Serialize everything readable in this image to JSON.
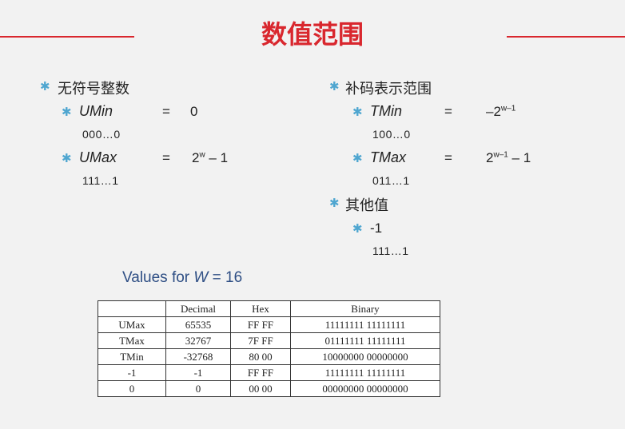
{
  "title": "数值范围",
  "left": {
    "heading": "无符号整数",
    "umin_name": "UMin",
    "umin_eq": "=",
    "umin_val": "0",
    "umin_bits": "000…0",
    "umax_name": "UMax",
    "umax_eq": "=",
    "umax_base": "2",
    "umax_exp": "w",
    "umax_tail": " – 1",
    "umax_bits": "111…1"
  },
  "right": {
    "heading": "补码表示范围",
    "tmin_name": "TMin",
    "tmin_eq": "=",
    "tmin_base": "–2",
    "tmin_exp": "w–1",
    "tmin_bits": "100…0",
    "tmax_name": "TMax",
    "tmax_eq": "=",
    "tmax_base": "2",
    "tmax_exp": "w–1",
    "tmax_tail": " – 1",
    "tmax_bits": "011…1",
    "other_heading": "其他值",
    "neg1": "-1",
    "neg1_bits": "111…1"
  },
  "values_label": {
    "prefix": "Values for ",
    "var": "W",
    "suffix": " = 16"
  },
  "table": {
    "headers": [
      "",
      "Decimal",
      "Hex",
      "Binary"
    ],
    "rows": [
      [
        "UMax",
        "65535",
        "FF FF",
        "11111111 11111111"
      ],
      [
        "TMax",
        "32767",
        "7F FF",
        "01111111 11111111"
      ],
      [
        "TMin",
        "-32768",
        "80 00",
        "10000000 00000000"
      ],
      [
        "-1",
        "-1",
        "FF FF",
        "11111111 11111111"
      ],
      [
        "0",
        "0",
        "00 00",
        "00000000 00000000"
      ]
    ]
  },
  "colors": {
    "accent": "#d9272e",
    "bullet": "#4fa6d0",
    "label": "#2e4e84"
  }
}
